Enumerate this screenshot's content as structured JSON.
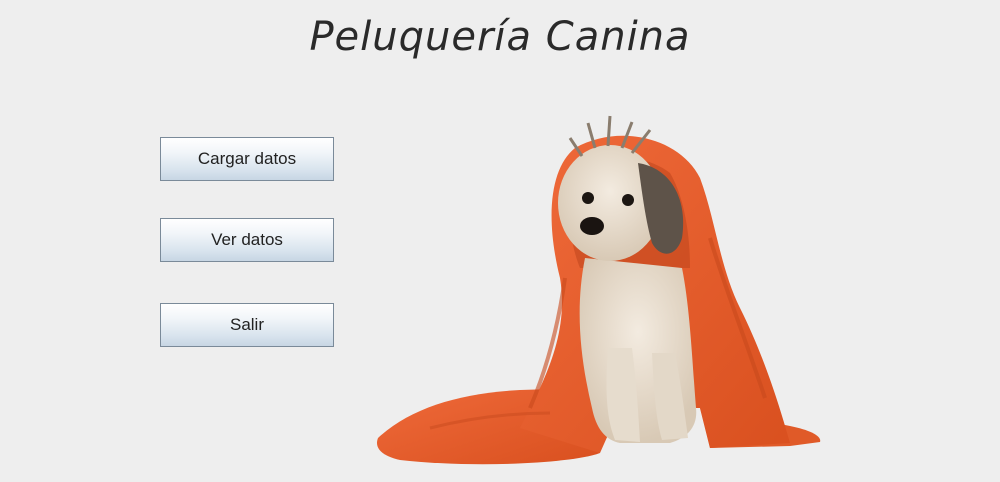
{
  "app": {
    "title": "Peluquería Canina"
  },
  "menu": {
    "load_label": "Cargar datos",
    "view_label": "Ver datos",
    "exit_label": "Salir"
  },
  "image": {
    "subject": "dog-in-orange-towel"
  }
}
